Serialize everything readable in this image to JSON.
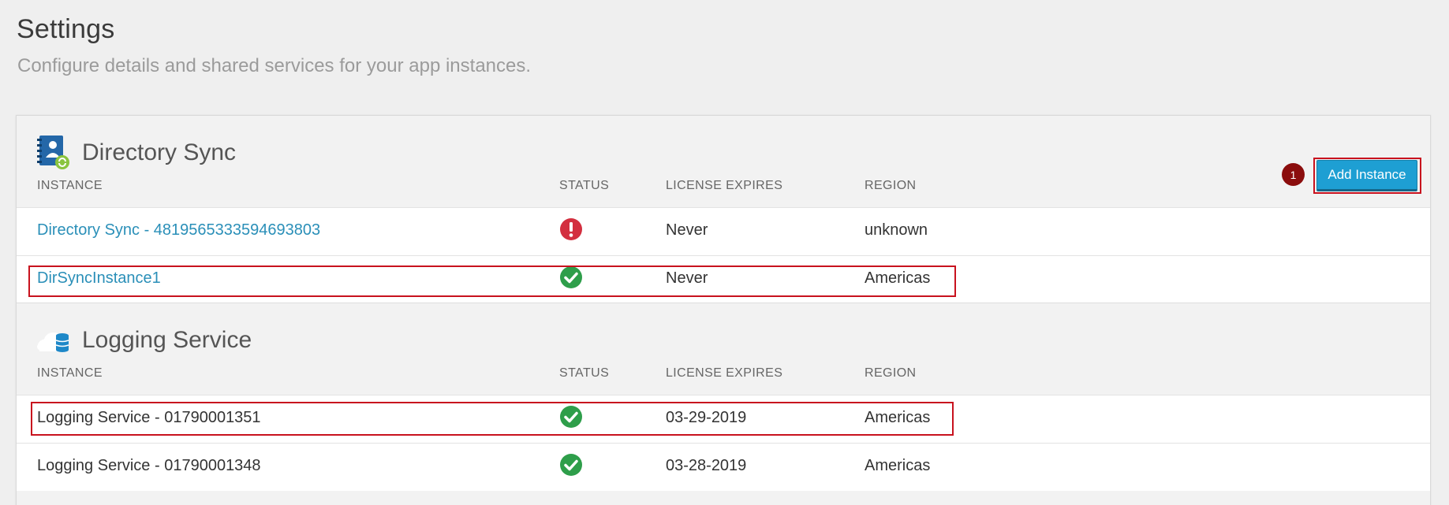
{
  "page": {
    "title": "Settings",
    "subtitle": "Configure details and shared services for your app instances."
  },
  "columns": {
    "instance": "INSTANCE",
    "status": "STATUS",
    "license_expires": "LICENSE EXPIRES",
    "region": "REGION"
  },
  "directory_sync": {
    "title": "Directory Sync",
    "icon": "directory-sync-icon",
    "add_button_label": "Add Instance",
    "step_badge": "1",
    "rows": [
      {
        "instance": "Directory Sync - 4819565333594693803",
        "status": "error",
        "license_expires": "Never",
        "region": "unknown",
        "is_link": true
      },
      {
        "instance": "DirSyncInstance1",
        "status": "ok",
        "license_expires": "Never",
        "region": "Americas",
        "is_link": true
      }
    ]
  },
  "logging_service": {
    "title": "Logging Service",
    "icon": "logging-service-icon",
    "rows": [
      {
        "instance": "Logging Service - 01790001351",
        "status": "ok",
        "license_expires": "03-29-2019",
        "region": "Americas",
        "is_link": false
      },
      {
        "instance": "Logging Service - 01790001348",
        "status": "ok",
        "license_expires": "03-28-2019",
        "region": "Americas",
        "is_link": false
      }
    ]
  },
  "colors": {
    "link": "#2a8fb8",
    "status_ok": "#2e9e4a",
    "status_error": "#d32f3f",
    "highlight": "#c8121e",
    "button": "#1e9fd3",
    "badge": "#8b0d0d"
  }
}
